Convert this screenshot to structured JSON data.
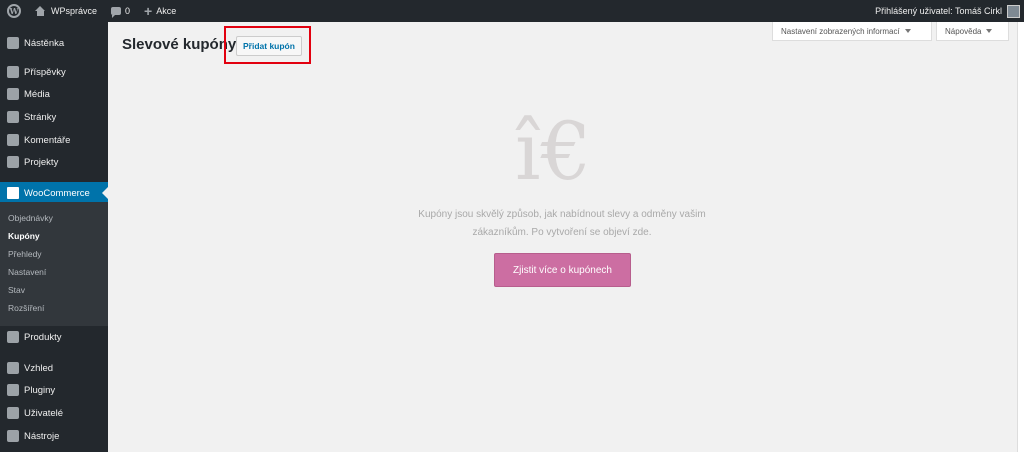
{
  "adminbar": {
    "site_name": "WPsprávce",
    "comments_count": "0",
    "new_label": "Akce",
    "user_greeting": "Přihlášený uživatel: Tomáš Cirkl"
  },
  "sidebar": {
    "items": [
      {
        "label": "Nástěnka",
        "icon": "dashboard-icon"
      },
      {
        "label": "Příspěvky",
        "icon": "pin-icon"
      },
      {
        "label": "Média",
        "icon": "media-icon"
      },
      {
        "label": "Stránky",
        "icon": "pages-icon"
      },
      {
        "label": "Komentáře",
        "icon": "comment-icon"
      },
      {
        "label": "Projekty",
        "icon": "pin-icon"
      },
      {
        "label": "WooCommerce",
        "icon": "woocommerce-icon"
      },
      {
        "label": "Produkty",
        "icon": "box-icon"
      },
      {
        "label": "Vzhled",
        "icon": "brush-icon"
      },
      {
        "label": "Pluginy",
        "icon": "plugin-icon"
      },
      {
        "label": "Uživatelé",
        "icon": "user-icon"
      },
      {
        "label": "Nástroje",
        "icon": "wrench-icon"
      }
    ],
    "submenu": [
      "Objednávky",
      "Kupóny",
      "Přehledy",
      "Nastavení",
      "Stav",
      "Rozšíření"
    ]
  },
  "main": {
    "title": "Slevové kupóny",
    "add_button": "Přidat kupón",
    "screen_options": "Nastavení zobrazených informací",
    "help": "Nápověda",
    "empty_glyph": "î€",
    "empty_message": "Kupóny jsou skvělý způsob, jak nabídnout slevy a odměny vašim zákazníkům. Po vytvoření se objeví zde.",
    "learn_more": "Zjistit více o kupónech"
  },
  "colors": {
    "admin_dark": "#23282d",
    "accent_blue": "#0073aa",
    "woo_purple": "#cc6ea2",
    "highlight_red": "#e2000f"
  }
}
